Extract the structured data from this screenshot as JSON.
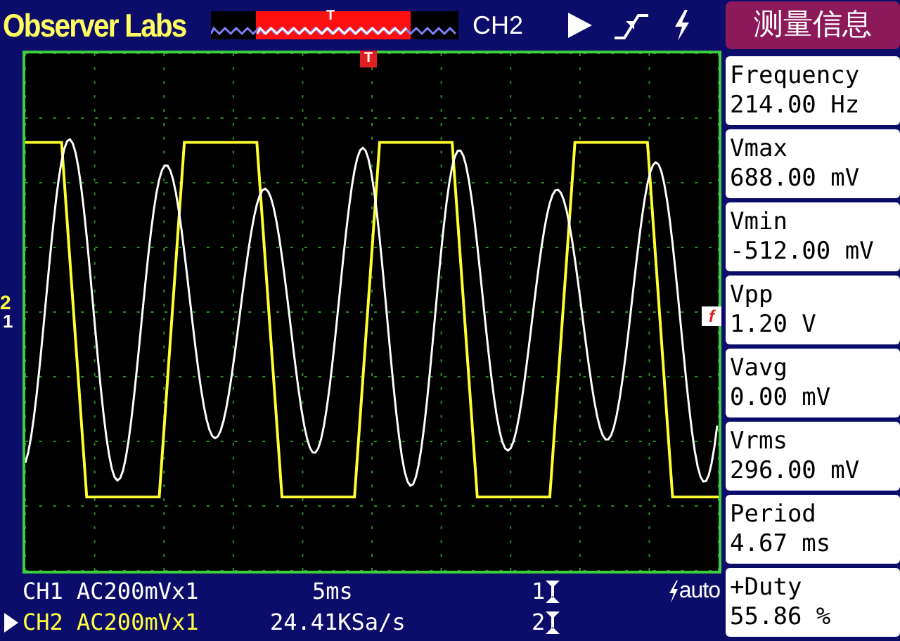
{
  "header": {
    "brand": "Observer Labs",
    "trigger_marker": "T",
    "channel": "CH2",
    "menu_title": "测量信息"
  },
  "markers": {
    "trigger_position": "T",
    "ch2": "2",
    "ch1": "1",
    "trigger_level": "f"
  },
  "measurements": [
    {
      "label": "Frequency",
      "value": "214.00 Hz"
    },
    {
      "label": "Vmax",
      "value": "688.00 mV"
    },
    {
      "label": "Vmin",
      "value": "-512.00 mV"
    },
    {
      "label": "Vpp",
      "value": "1.20 V"
    },
    {
      "label": "Vavg",
      "value": "0.00 mV"
    },
    {
      "label": "Vrms",
      "value": "296.00 mV"
    },
    {
      "label": "Period",
      "value": "4.67 ms"
    },
    {
      "label": "+Duty",
      "value": "55.86 %"
    }
  ],
  "status": {
    "rows": [
      {
        "channel": "CH1 AC200mVx1",
        "reading": "5ms",
        "cursor": "1",
        "color": "#ffffff",
        "selected": false
      },
      {
        "channel": "CH2 AC200mVx1",
        "reading": "24.41KSa/s",
        "cursor": "2",
        "color": "#ffff40",
        "selected": true
      }
    ],
    "trigger_mode": "auto"
  }
}
